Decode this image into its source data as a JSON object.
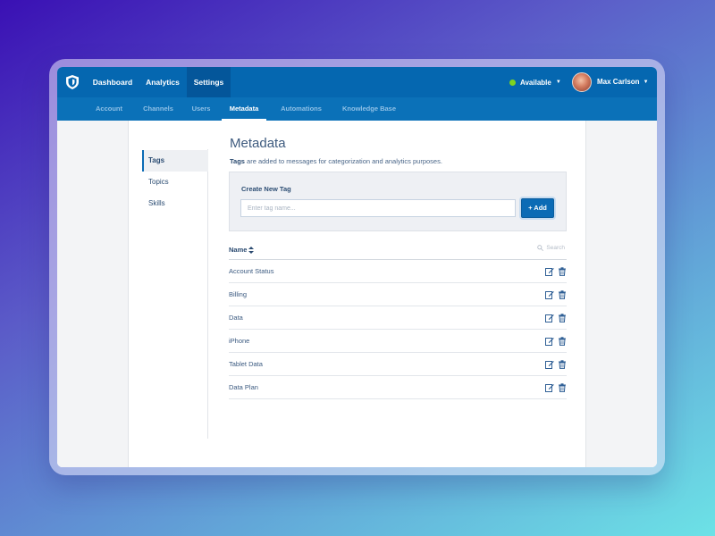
{
  "app": {
    "nav_tabs": [
      {
        "label": "Dashboard"
      },
      {
        "label": "Analytics"
      },
      {
        "label": "Settings"
      }
    ],
    "status_label": "Available",
    "user_name": "Max Carlson"
  },
  "subnav": {
    "tabs": [
      {
        "label": "Account"
      },
      {
        "label": "Channels"
      },
      {
        "label": "Users"
      },
      {
        "label": "Metadata"
      },
      {
        "label": "Automations"
      },
      {
        "label": "Knowledge Base"
      }
    ]
  },
  "sidebar": {
    "items": [
      {
        "label": "Tags"
      },
      {
        "label": "Topics"
      },
      {
        "label": "Skills"
      }
    ]
  },
  "page": {
    "title": "Metadata",
    "desc_strong": "Tags",
    "desc_rest": " are added to messages for categorization and analytics purposes."
  },
  "create": {
    "label": "Create New Tag",
    "placeholder": "Enter tag name...",
    "add_label": "+ Add"
  },
  "table": {
    "column": "Name",
    "search_placeholder": "Search",
    "rows": [
      {
        "label": "Account Status"
      },
      {
        "label": "Billing"
      },
      {
        "label": "Data"
      },
      {
        "label": "iPhone"
      },
      {
        "label": "Tablet Data"
      },
      {
        "label": "Data Plan"
      }
    ]
  },
  "colors": {
    "primary": "#0567b0",
    "subnav": "#0b71b8",
    "status_online": "#7ed321"
  },
  "icons": [
    "shield-logo-icon",
    "caret-down-icon",
    "sort-icon",
    "search-icon",
    "edit-icon",
    "trash-icon"
  ]
}
